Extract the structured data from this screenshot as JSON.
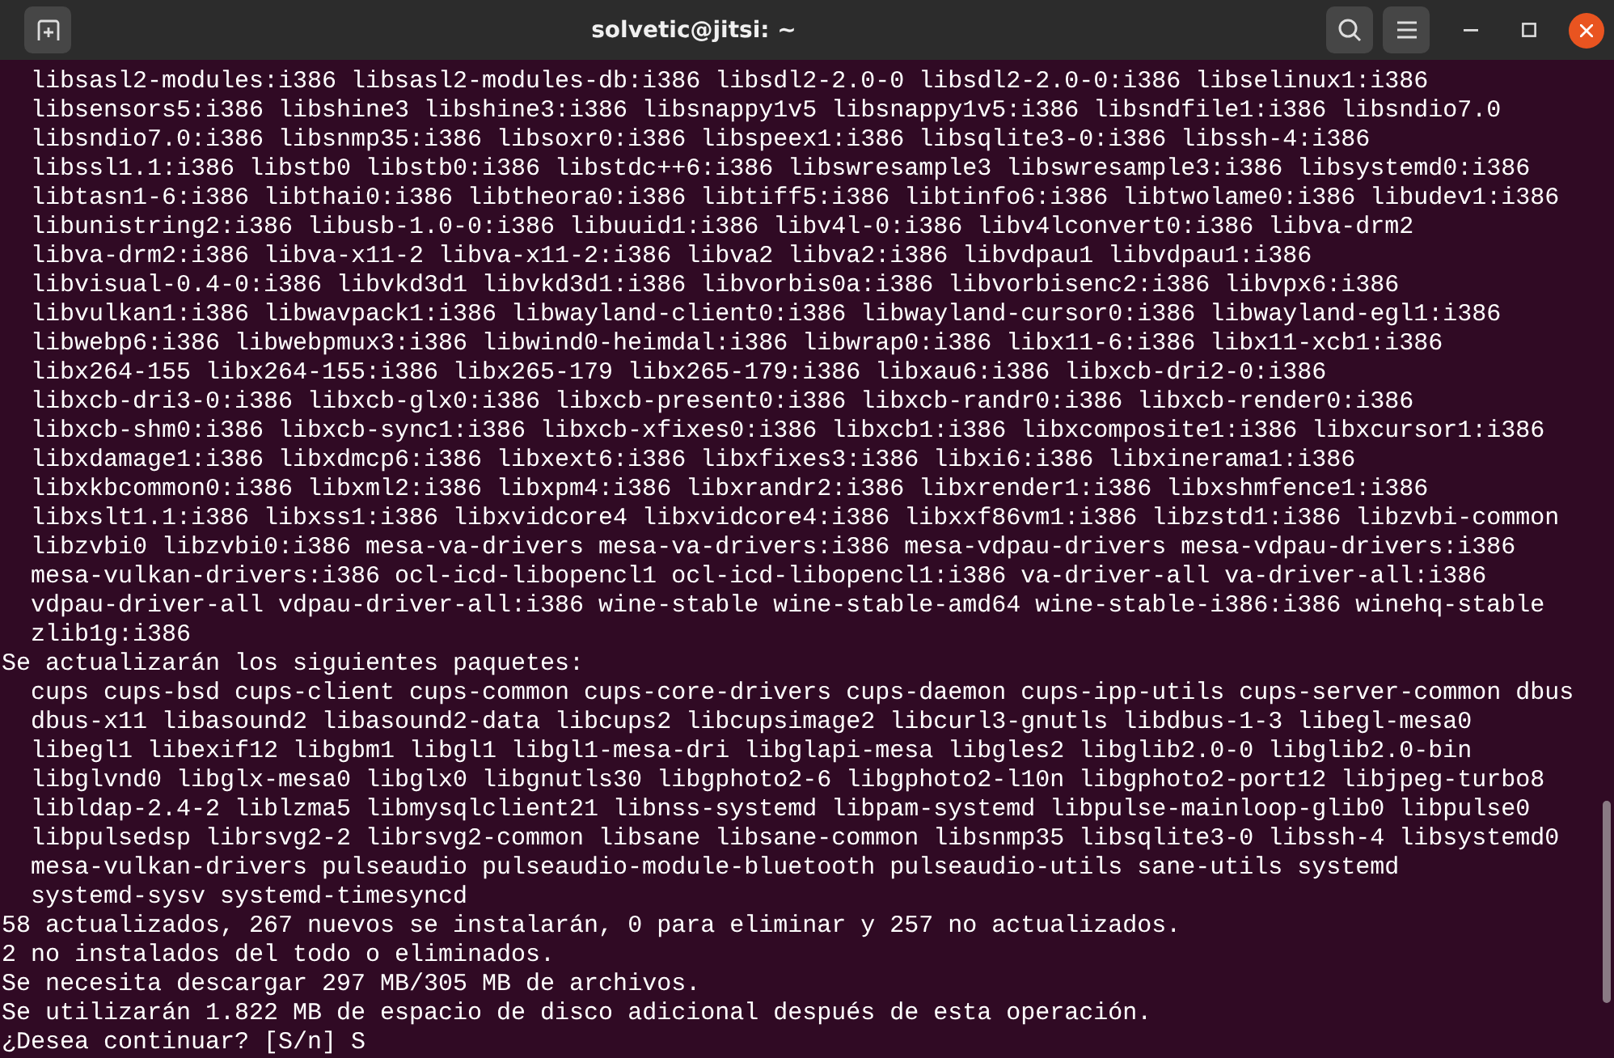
{
  "window": {
    "title": "solvetic@jitsi: ~"
  },
  "terminal": {
    "sections": [
      {
        "package_lines": [
          "libsasl2-modules:i386 libsasl2-modules-db:i386 libsdl2-2.0-0 libsdl2-2.0-0:i386 libselinux1:i386",
          "libsensors5:i386 libshine3 libshine3:i386 libsnappy1v5 libsnappy1v5:i386 libsndfile1:i386 libsndio7.0",
          "libsndio7.0:i386 libsnmp35:i386 libsoxr0:i386 libspeex1:i386 libsqlite3-0:i386 libssh-4:i386",
          "libssl1.1:i386 libstb0 libstb0:i386 libstdc++6:i386 libswresample3 libswresample3:i386 libsystemd0:i386",
          "libtasn1-6:i386 libthai0:i386 libtheora0:i386 libtiff5:i386 libtinfo6:i386 libtwolame0:i386 libudev1:i386",
          "libunistring2:i386 libusb-1.0-0:i386 libuuid1:i386 libv4l-0:i386 libv4lconvert0:i386 libva-drm2",
          "libva-drm2:i386 libva-x11-2 libva-x11-2:i386 libva2 libva2:i386 libvdpau1 libvdpau1:i386",
          "libvisual-0.4-0:i386 libvkd3d1 libvkd3d1:i386 libvorbis0a:i386 libvorbisenc2:i386 libvpx6:i386",
          "libvulkan1:i386 libwavpack1:i386 libwayland-client0:i386 libwayland-cursor0:i386 libwayland-egl1:i386",
          "libwebp6:i386 libwebpmux3:i386 libwind0-heimdal:i386 libwrap0:i386 libx11-6:i386 libx11-xcb1:i386",
          "libx264-155 libx264-155:i386 libx265-179 libx265-179:i386 libxau6:i386 libxcb-dri2-0:i386",
          "libxcb-dri3-0:i386 libxcb-glx0:i386 libxcb-present0:i386 libxcb-randr0:i386 libxcb-render0:i386",
          "libxcb-shm0:i386 libxcb-sync1:i386 libxcb-xfixes0:i386 libxcb1:i386 libxcomposite1:i386 libxcursor1:i386",
          "libxdamage1:i386 libxdmcp6:i386 libxext6:i386 libxfixes3:i386 libxi6:i386 libxinerama1:i386",
          "libxkbcommon0:i386 libxml2:i386 libxpm4:i386 libxrandr2:i386 libxrender1:i386 libxshmfence1:i386",
          "libxslt1.1:i386 libxss1:i386 libxvidcore4 libxvidcore4:i386 libxxf86vm1:i386 libzstd1:i386 libzvbi-common",
          "libzvbi0 libzvbi0:i386 mesa-va-drivers mesa-va-drivers:i386 mesa-vdpau-drivers mesa-vdpau-drivers:i386",
          "mesa-vulkan-drivers:i386 ocl-icd-libopencl1 ocl-icd-libopencl1:i386 va-driver-all va-driver-all:i386",
          "vdpau-driver-all vdpau-driver-all:i386 wine-stable wine-stable-amd64 wine-stable-i386:i386 winehq-stable",
          "zlib1g:i386"
        ]
      },
      {
        "heading": "Se actualizarán los siguientes paquetes:",
        "package_lines": [
          "cups cups-bsd cups-client cups-common cups-core-drivers cups-daemon cups-ipp-utils cups-server-common dbus",
          "dbus-x11 libasound2 libasound2-data libcups2 libcupsimage2 libcurl3-gnutls libdbus-1-3 libegl-mesa0",
          "libegl1 libexif12 libgbm1 libgl1 libgl1-mesa-dri libglapi-mesa libgles2 libglib2.0-0 libglib2.0-bin",
          "libglvnd0 libglx-mesa0 libglx0 libgnutls30 libgphoto2-6 libgphoto2-l10n libgphoto2-port12 libjpeg-turbo8",
          "libldap-2.4-2 liblzma5 libmysqlclient21 libnss-systemd libpam-systemd libpulse-mainloop-glib0 libpulse0",
          "libpulsedsp librsvg2-2 librsvg2-common libsane libsane-common libsnmp35 libsqlite3-0 libssh-4 libsystemd0",
          "mesa-vulkan-drivers pulseaudio pulseaudio-module-bluetooth pulseaudio-utils sane-utils systemd",
          "systemd-sysv systemd-timesyncd"
        ]
      },
      {
        "messages": [
          "58 actualizados, 267 nuevos se instalarán, 0 para eliminar y 257 no actualizados.",
          "2 no instalados del todo o eliminados.",
          "Se necesita descargar 297 MB/305 MB de archivos.",
          "Se utilizarán 1.822 MB de espacio de disco adicional después de esta operación.",
          "¿Desea continuar? [S/n] S"
        ]
      }
    ]
  }
}
